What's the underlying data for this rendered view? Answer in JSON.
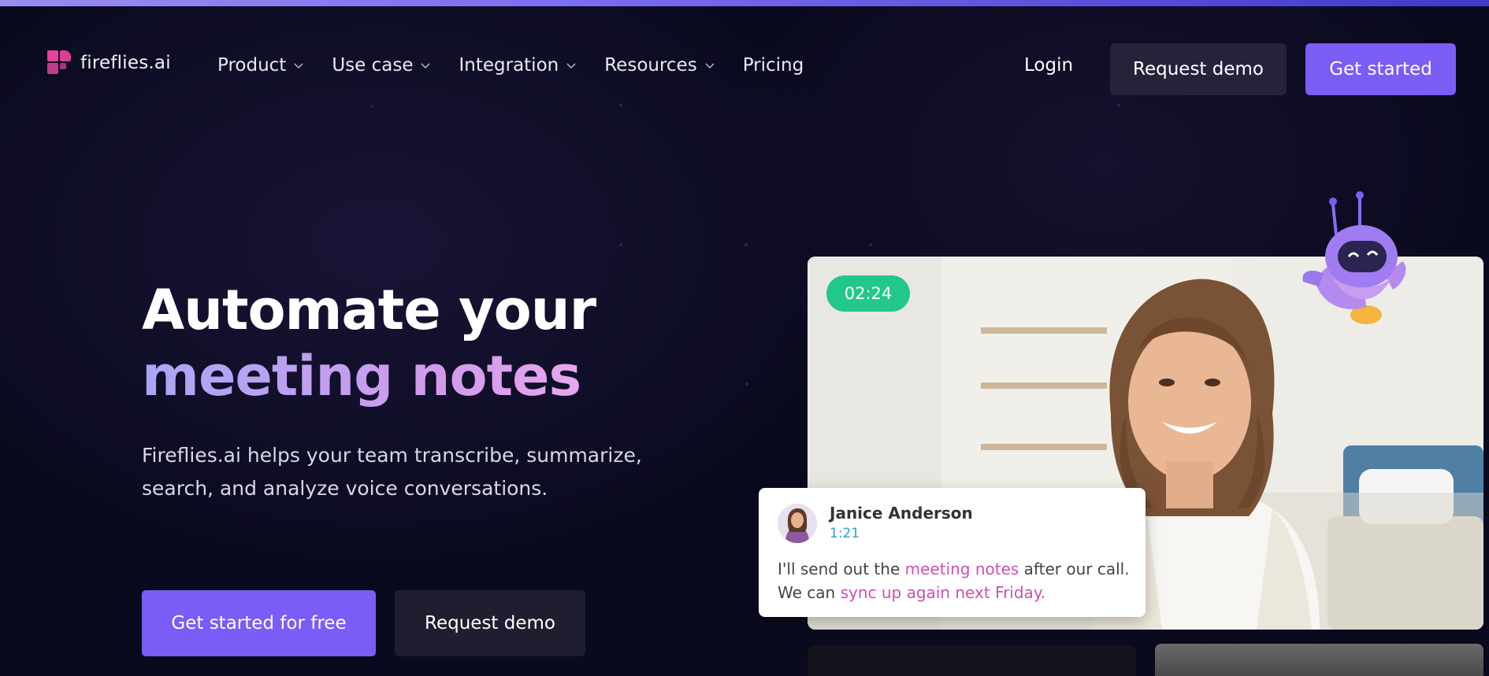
{
  "brand": {
    "name": "fireflies.ai",
    "colors": {
      "accent": "#7b5cf6",
      "logo": "#e8439a",
      "timer": "#22c889",
      "highlight": "#cf4fb1"
    }
  },
  "nav": {
    "menu": [
      {
        "label": "Product",
        "icon": "chevron-down-icon"
      },
      {
        "label": "Use case",
        "icon": "chevron-down-icon"
      },
      {
        "label": "Integration",
        "icon": "chevron-down-icon"
      },
      {
        "label": "Resources",
        "icon": "chevron-down-icon"
      },
      {
        "label": "Pricing"
      }
    ],
    "login": "Login",
    "request_demo": "Request demo",
    "get_started": "Get started"
  },
  "hero": {
    "title_line1": "Automate your",
    "title_line2": "meeting notes",
    "subtitle": "Fireflies.ai helps your team transcribe, summarize, search, and analyze voice conversations.",
    "cta_primary": "Get started for free",
    "cta_secondary": "Request demo"
  },
  "media": {
    "timer": "02:24",
    "transcript": {
      "speaker": "Janice Anderson",
      "time": "1:21",
      "text_part1": "I'll send out the ",
      "highlight1": "meeting notes",
      "text_part2": " after our call. We can ",
      "highlight2": "sync up again next Friday."
    }
  }
}
